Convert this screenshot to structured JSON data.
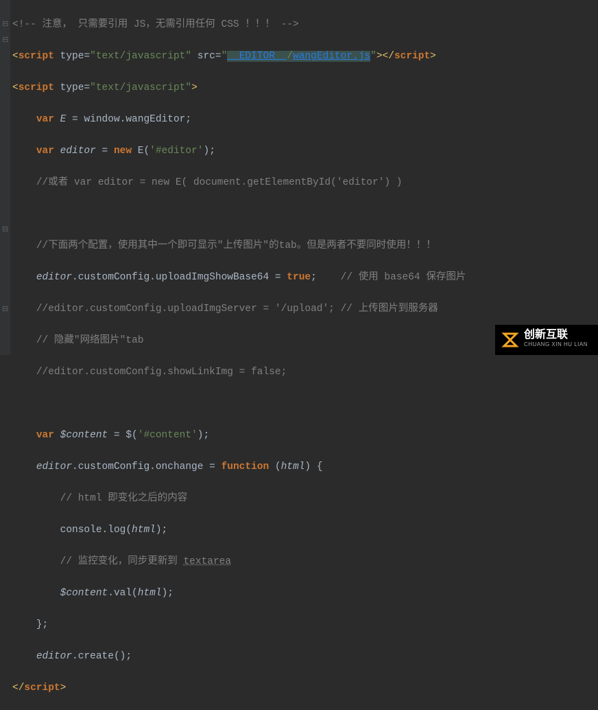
{
  "lines": {
    "l1_cmt": "<!-- 注意， 只需要引用 JS，无需引用任何 CSS ！！！ -->",
    "l2_tag_open": "<",
    "l2_tag_name": "script ",
    "l2_attr1": "type=",
    "l2_val1": "\"text/javascript\"",
    "l2_attr2": " src=",
    "l2_val2a": "\"",
    "l2_val2_link1": "__EDITOR__",
    "l2_val2_mid": "/",
    "l2_val2_link2": "wangEditor.js",
    "l2_val2b": "\"",
    "l2_tag_close": "></",
    "l2_tag_name2": "script",
    "l2_tag_close2": ">",
    "l3_tag_open": "<",
    "l3_tag_name": "script ",
    "l3_attr1": "type=",
    "l3_val1": "\"text/javascript\"",
    "l3_tag_close": ">",
    "l4_kw": "var",
    "l4_v": " E ",
    "l4_eq": "= ",
    "l4_rhs": "window.wangEditor;",
    "l5_kw": "var",
    "l5_v": " editor ",
    "l5_eq": "= ",
    "l5_new": "new ",
    "l5_ctor": "E(",
    "l5_str": "'#editor'",
    "l5_end": ");",
    "l6_cmt": "//或者 var editor = new E( document.getElementById('editor') )",
    "l8_cmt": "//下面两个配置，使用其中一个即可显示\"上传图片\"的tab。但是两者不要同时使用！！！",
    "l9_lhs_obj": "editor",
    "l9_lhs_rest": ".customConfig.uploadImgShowBase64 ",
    "l9_eq": "= ",
    "l9_rhs": "true",
    "l9_semi": ";",
    "l9_cmt": "    // 使用 base64 保存图片",
    "l10_cmt": "//editor.customConfig.uploadImgServer = '/upload'; // 上传图片到服务器",
    "l11_cmt": "// 隐藏\"网络图片\"tab",
    "l12_cmt": "//editor.customConfig.showLinkImg = false;",
    "l14_kw": "var",
    "l14_v": " $content ",
    "l14_eq": "= ",
    "l14_fn": "$(",
    "l14_str": "'#content'",
    "l14_end": ");",
    "l15_lhs_obj": "editor",
    "l15_lhs_rest": ".customConfig.onchange ",
    "l15_eq": "= ",
    "l15_fn": "function ",
    "l15_args": "(",
    "l15_arg1": "html",
    "l15_args2": ") {",
    "l16_cmt": "// html 即变化之后的内容",
    "l17_a": "console.log(",
    "l17_arg": "html",
    "l17_b": ");",
    "l18_cmt_a": "// 监控变化，同步更新到 ",
    "l18_cmt_b": "textarea",
    "l19_obj": "$content",
    "l19_rest": ".val(",
    "l19_arg": "html",
    "l19_end": ");",
    "l20": "};",
    "l21_obj": "editor",
    "l21_rest": ".create();",
    "l22_open": "</",
    "l22_tag": "script",
    "l22_close": ">"
  },
  "folds": [
    "⊟",
    "⊟",
    "⊟",
    "⊟"
  ],
  "watermark": {
    "brand": "创新互联",
    "sub": "CHUANG XIN HU LIAN"
  }
}
